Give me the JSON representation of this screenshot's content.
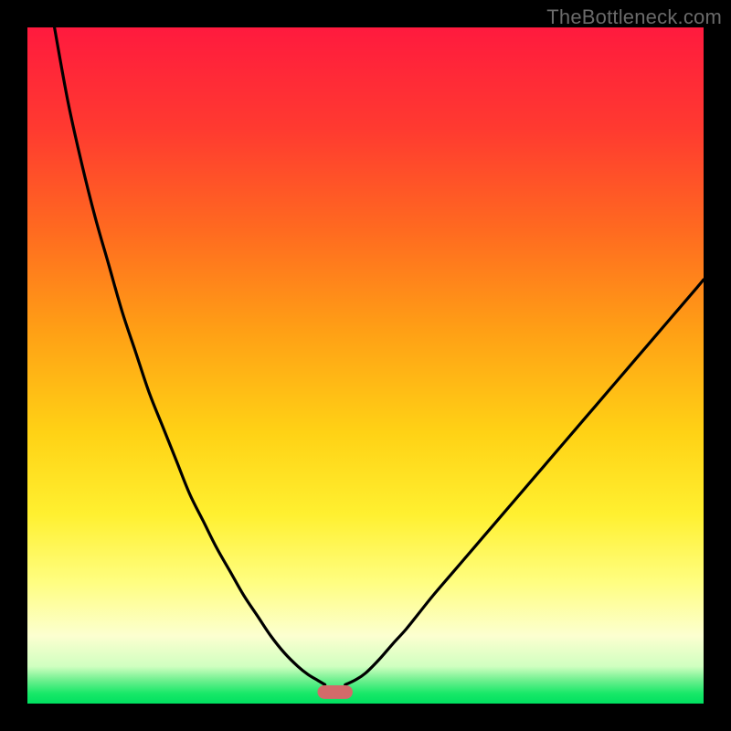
{
  "watermark": "TheBottleneck.com",
  "chart_data": {
    "type": "line",
    "title": "",
    "xlabel": "",
    "ylabel": "",
    "xlim": [
      0,
      100
    ],
    "ylim": [
      0,
      100
    ],
    "grid": false,
    "legend": false,
    "background_gradient_stops": [
      {
        "offset": 0.0,
        "color": "#ff1a3e"
      },
      {
        "offset": 0.15,
        "color": "#ff3a30"
      },
      {
        "offset": 0.3,
        "color": "#ff6a20"
      },
      {
        "offset": 0.45,
        "color": "#ffa015"
      },
      {
        "offset": 0.6,
        "color": "#ffd215"
      },
      {
        "offset": 0.72,
        "color": "#fff030"
      },
      {
        "offset": 0.82,
        "color": "#fffe80"
      },
      {
        "offset": 0.9,
        "color": "#fcffd0"
      },
      {
        "offset": 0.945,
        "color": "#d0ffc0"
      },
      {
        "offset": 0.965,
        "color": "#70f090"
      },
      {
        "offset": 0.985,
        "color": "#18e868"
      },
      {
        "offset": 1.0,
        "color": "#00e060"
      }
    ],
    "marker": {
      "center_x": 45.5,
      "y_top": 97.3,
      "width": 5.2,
      "height": 2.0,
      "radius": 1.0,
      "fill": "#d36a6a"
    },
    "series": [
      {
        "name": "left",
        "x": [
          4.0,
          6,
          8,
          10,
          12,
          14,
          16,
          18,
          20,
          22,
          24,
          26,
          28,
          30,
          32,
          34,
          36,
          38,
          40,
          41.5,
          43,
          44
        ],
        "y": [
          0.0,
          11,
          20,
          28,
          35,
          42,
          48,
          54,
          59,
          64,
          69,
          73,
          77,
          80.5,
          84,
          87,
          90,
          92.5,
          94.5,
          95.7,
          96.6,
          97.2
        ]
      },
      {
        "name": "right",
        "x": [
          47,
          48.5,
          50,
          52,
          54,
          56,
          58,
          60,
          63,
          66,
          69,
          72,
          75,
          78,
          81,
          84,
          87,
          90,
          93,
          96,
          99,
          100
        ],
        "y": [
          97.2,
          96.5,
          95.5,
          93.5,
          91.2,
          89,
          86.5,
          84,
          80.5,
          77,
          73.5,
          70,
          66.5,
          63,
          59.5,
          56,
          52.5,
          49,
          45.5,
          42,
          38.5,
          37.3
        ]
      }
    ]
  }
}
